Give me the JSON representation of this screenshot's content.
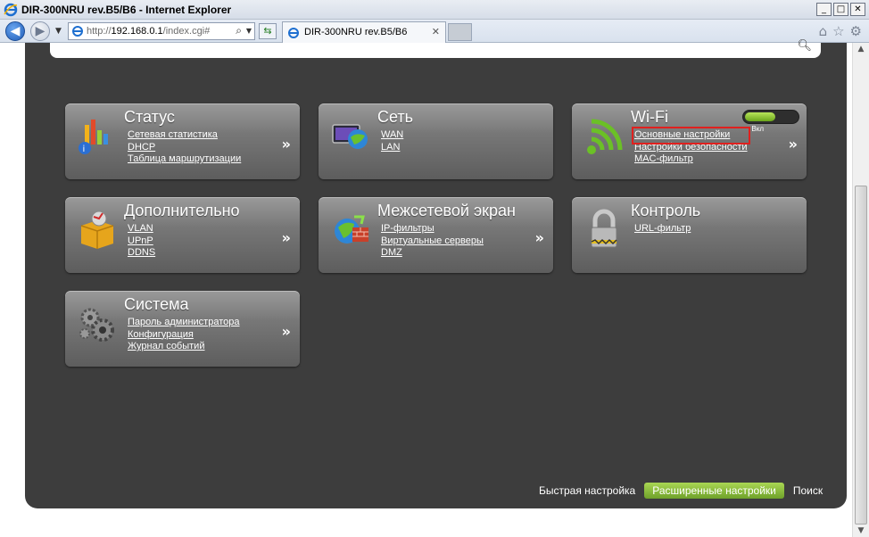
{
  "window": {
    "title": "DIR-300NRU rev.B5/B6 - Internet Explorer",
    "buttons": [
      "_",
      "□",
      "✕"
    ]
  },
  "browser": {
    "url_prefix": "http://",
    "url_host": "192.168.0.1",
    "url_path": "/index.cgi#",
    "tab_title": "DIR-300NRU rev.B5/B6",
    "tab_close": "✕",
    "icons": [
      "home-icon",
      "star-icon",
      "gear-icon"
    ]
  },
  "cards": {
    "status": {
      "title": "Статус",
      "links": [
        "Сетевая статистика",
        "DHCP",
        "Таблица маршрутизации"
      ],
      "icon": "chart-icon"
    },
    "network": {
      "title": "Сеть",
      "links": [
        "WAN",
        "LAN"
      ],
      "icon": "globe-monitor-icon"
    },
    "wifi": {
      "title": "Wi-Fi",
      "links": [
        "Основные настройки",
        "Настройки безопасности",
        "MAC-фильтр"
      ],
      "icon": "wifi-icon",
      "toggle_label": "Вкл"
    },
    "extra": {
      "title": "Дополнительно",
      "links": [
        "VLAN",
        "UPnP",
        "DDNS"
      ],
      "icon": "box-icon"
    },
    "firewall": {
      "title": "Межсетевой экран",
      "links": [
        "IP-фильтры",
        "Виртуальные серверы",
        "DMZ"
      ],
      "icon": "firewall-icon"
    },
    "control": {
      "title": "Контроль",
      "links": [
        "URL-фильтр"
      ],
      "icon": "lock-icon"
    },
    "system": {
      "title": "Система",
      "links": [
        "Пароль администратора",
        "Конфигурация",
        "Журнал событий"
      ],
      "icon": "gears-icon"
    }
  },
  "chevron": "»",
  "footer": {
    "quick": "Быстрая настройка",
    "advanced": "Расширенные настройки",
    "search": "Поиск"
  }
}
